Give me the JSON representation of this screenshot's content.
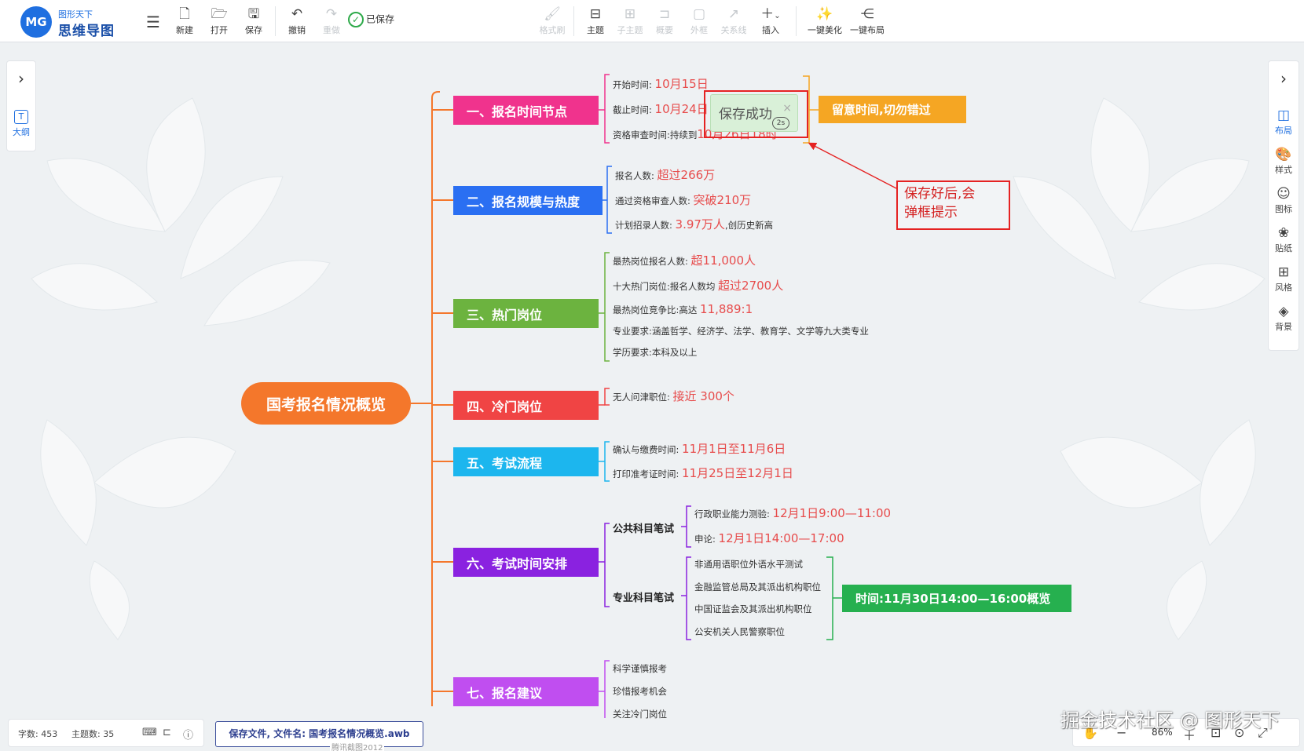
{
  "app": {
    "logo_short": "MG",
    "logo_sub": "图形天下",
    "logo_name": "思维导图"
  },
  "toolbar": {
    "new": "新建",
    "open": "打开",
    "save": "保存",
    "undo": "撤销",
    "redo": "重做",
    "saved": "已保存",
    "format_brush": "格式刷",
    "topic": "主题",
    "subtopic": "子主题",
    "summary": "概要",
    "frame": "外框",
    "relation": "关系线",
    "insert": "插入",
    "beautify": "一键美化",
    "layout": "一键布局"
  },
  "left_panel": {
    "outline": "大纲"
  },
  "right_panel": {
    "layout": "布局",
    "style": "样式",
    "icon": "图标",
    "sticker": "贴纸",
    "theme": "风格",
    "background": "背景"
  },
  "map": {
    "central": "国考报名情况概览",
    "b1": {
      "title": "一、报名时间节点",
      "color": "#f0338d",
      "l1_label": "开始时间:",
      "l1_val": "10月15日",
      "l2_label": "截止时间:",
      "l2_val": "10月24日",
      "l3_label": "资格审查时间:持续到",
      "l3_val": "10月26日18时",
      "note": "留意时间,切勿错过",
      "note_color": "#f5a623"
    },
    "b2": {
      "title": "二、报名规模与热度",
      "color": "#2a6ff2",
      "l1_label": "报名人数:",
      "l1_val": "超过266万",
      "l2_label": "通过资格审查人数:",
      "l2_val": "突破210万",
      "l3_label": "计划招录人数:",
      "l3_val": "3.97万人",
      "l3_tail": ",创历史新高"
    },
    "b3": {
      "title": "三、热门岗位",
      "color": "#6cb33f",
      "l1_label": "最热岗位报名人数:",
      "l1_val": "超11,000人",
      "l2_label": "十大热门岗位:报名人数均",
      "l2_val": "超过2700人",
      "l3_label": "最热岗位竞争比:高达",
      "l3_val": "11,889:1",
      "l4_label": "专业要求:涵盖哲学、经济学、法学、教育学、文学等九大类专业",
      "l5_label": "学历要求:本科及以上"
    },
    "b4": {
      "title": "四、冷门岗位",
      "color": "#f04444",
      "l1_label": "无人问津职位:",
      "l1_val": "接近 300个"
    },
    "b5": {
      "title": "五、考试流程",
      "color": "#1cb6ee",
      "l1_label": "确认与缴费时间:",
      "l1_val": "11月1日至11月6日",
      "l2_label": "打印准考证时间:",
      "l2_val": "11月25日至12月1日"
    },
    "b6": {
      "title": "六、考试时间安排",
      "color": "#8a22e0",
      "s1": "公共科目笔试",
      "s1_l1_label": "行政职业能力测验:",
      "s1_l1_val": "12月1日9:00—11:00",
      "s1_l2_label": "申论:",
      "s1_l2_val": "12月1日14:00—17:00",
      "s2": "专业科目笔试",
      "s2_l1": "非通用语职位外语水平测试",
      "s2_l2": "金融监管总局及其派出机构职位",
      "s2_l3": "中国证监会及其派出机构职位",
      "s2_l4": "公安机关人民警察职位",
      "note": "时间:11月30日14:00—16:00概览",
      "note_color": "#26b04f"
    },
    "b7": {
      "title": "七、报名建议",
      "color": "#c04ef0",
      "l1": "科学谨慎报考",
      "l2": "珍惜报考机会",
      "l3": "关注冷门岗位"
    }
  },
  "toast": {
    "text": "保存成功",
    "timer": "2s"
  },
  "annotation": {
    "text_line1": "保存好后,会",
    "text_line2": "弹框提示"
  },
  "status": {
    "word_count": "字数: 453",
    "topic_count": "主题数: 35",
    "file_msg": "保存文件, 文件名: 国考报名情况概览.awb",
    "small_watermark": "腾讯截图2012",
    "zoom": "86%"
  },
  "watermark": "掘金技术社区 @ 图形天下"
}
